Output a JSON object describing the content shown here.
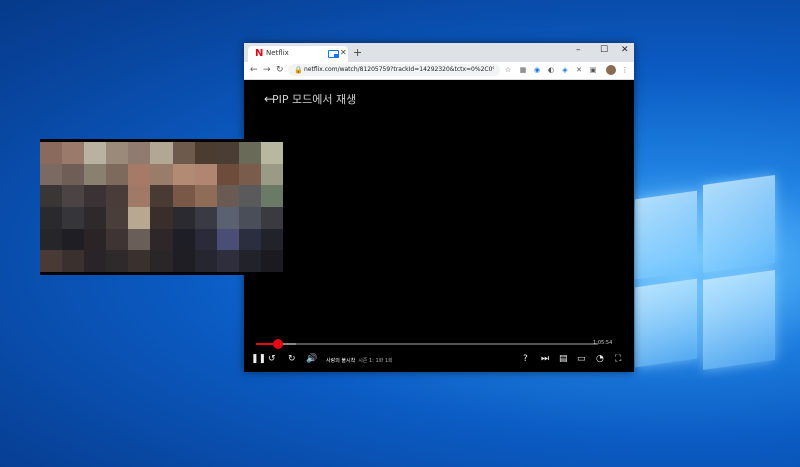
{
  "browser": {
    "tab": {
      "title": "Netflix",
      "logo": "N"
    },
    "new_tab": "+",
    "controls": {
      "minimize": "–",
      "maximize": "☐",
      "close": "✕"
    },
    "nav": {
      "back": "←",
      "forward": "→",
      "reload": "↻"
    },
    "url": "netflix.com/watch/81205759?trackId=14292320&tctx=0%2C0%2C1a6e..."
  },
  "player": {
    "back": "←",
    "pip_label": "PIP 모드에서 재생",
    "time_remaining": "1:05:54",
    "now_playing": {
      "title": "사랑의 불시착",
      "episode": "시즌 1: 1화 1회"
    },
    "progress_fraction": 0.06,
    "accent_color": "#e50914"
  },
  "pip_colors": [
    [
      "#8a6a5c",
      "#9a7a6a",
      "#b9b2a2",
      "#9b8a7a",
      "#8f7b70",
      "#b0a894",
      "#6e5a4c",
      "#4c3c30",
      "#4a3e34",
      "#6a6a58",
      "#b8b8a0"
    ],
    [
      "#7a6a62",
      "#6e5e56",
      "#8a8070",
      "#7e6a5c",
      "#a77a66",
      "#9a7c6a",
      "#b38a74",
      "#b08672",
      "#6e4c3c",
      "#7a5c4c",
      "#9a9a86"
    ],
    [
      "#3a3636",
      "#4c4444",
      "#3a3234",
      "#4a3c38",
      "#a07a66",
      "#4a3a34",
      "#7a5848",
      "#8e6c58",
      "#6a5a54",
      "#5a5a5c",
      "#6a7a66"
    ],
    [
      "#2a2a2e",
      "#36363a",
      "#2e2a2c",
      "#4a3e3a",
      "#b8a892",
      "#3a2e2c",
      "#2a2a30",
      "#3a3a44",
      "#5a6272",
      "#4a4e58",
      "#3a3a40"
    ],
    [
      "#26262a",
      "#1e1e24",
      "#2a2426",
      "#3e3434",
      "#6a5e58",
      "#2e2628",
      "#1e1e26",
      "#2a2a38",
      "#4a4e74",
      "#2a2e3e",
      "#22222a"
    ],
    [
      "#4a3a36",
      "#3a302e",
      "#2a2428",
      "#2e2a2c",
      "#3a302e",
      "#2a2628",
      "#1e1e24",
      "#262630",
      "#2e2e3c",
      "#22222a",
      "#1a1a20"
    ]
  ]
}
